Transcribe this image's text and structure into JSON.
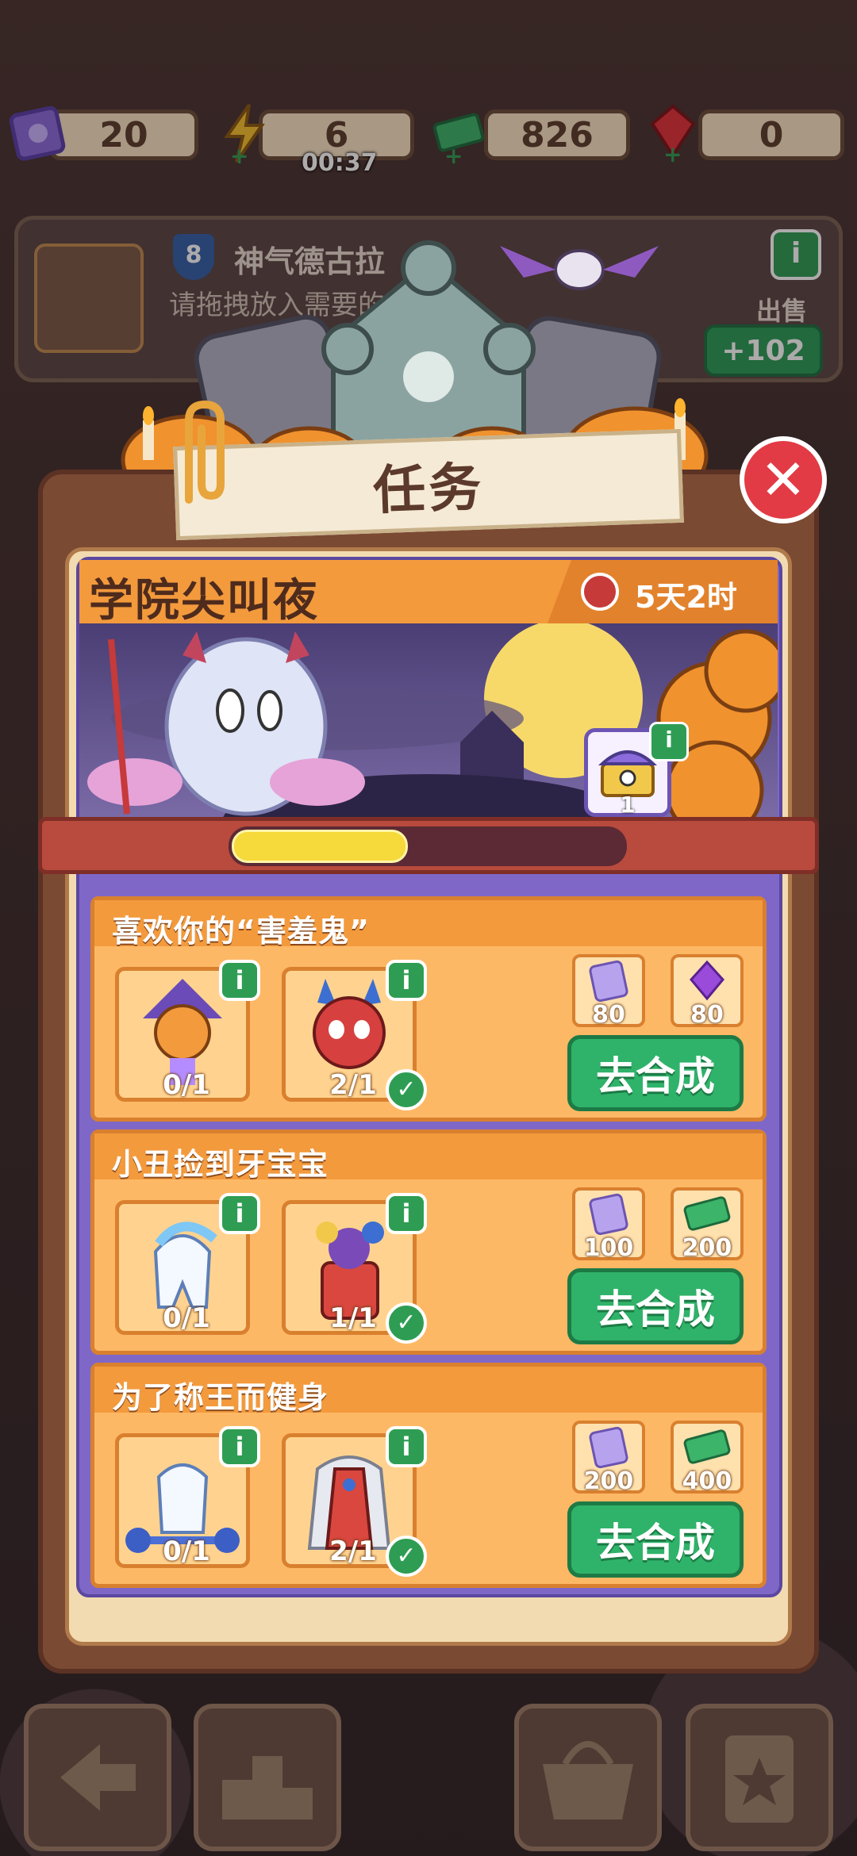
{
  "resources": [
    {
      "icon": "ticket-icon",
      "value": "20"
    },
    {
      "icon": "energy-icon",
      "value": "6",
      "timer": "00:37"
    },
    {
      "icon": "cash-icon",
      "value": "826"
    },
    {
      "icon": "ruby-icon",
      "value": "0"
    }
  ],
  "collector": {
    "level": "8",
    "name": "神气德古拉",
    "hint": "请拖拽放入需要的物",
    "sell_label": "出售",
    "sell_value": "+102"
  },
  "popup": {
    "title": "任务",
    "event": {
      "title": "学院尖叫夜",
      "time_left": "5天2时",
      "progress": 0.45,
      "chest_count": "1"
    },
    "tasks": [
      {
        "title": "喜欢你的“害羞鬼”",
        "items": [
          {
            "icon": "pumpkin-scarecrow-icon",
            "count": "0/1",
            "done": false
          },
          {
            "icon": "red-devil-icon",
            "count": "2/1",
            "done": true
          }
        ],
        "rewards": [
          {
            "icon": "ticket-icon",
            "value": "80"
          },
          {
            "icon": "purple-gem-icon",
            "value": "80"
          }
        ],
        "button": "去合成"
      },
      {
        "title": "小丑捡到牙宝宝",
        "items": [
          {
            "icon": "tooth-baby-icon",
            "count": "0/1",
            "done": false
          },
          {
            "icon": "clown-icon",
            "count": "1/1",
            "done": true
          }
        ],
        "rewards": [
          {
            "icon": "ticket-icon",
            "value": "100"
          },
          {
            "icon": "cash-icon",
            "value": "200"
          }
        ],
        "button": "去合成"
      },
      {
        "title": "为了称王而健身",
        "items": [
          {
            "icon": "tooth-lifter-icon",
            "count": "0/1",
            "done": false
          },
          {
            "icon": "royal-robe-icon",
            "count": "2/1",
            "done": true
          }
        ],
        "rewards": [
          {
            "icon": "ticket-icon",
            "value": "200"
          },
          {
            "icon": "cash-icon",
            "value": "400"
          }
        ],
        "button": "去合成"
      }
    ]
  },
  "nav": [
    "back-arrow-icon",
    "podium-icon",
    "basket-icon",
    "clipboard-star-icon"
  ]
}
